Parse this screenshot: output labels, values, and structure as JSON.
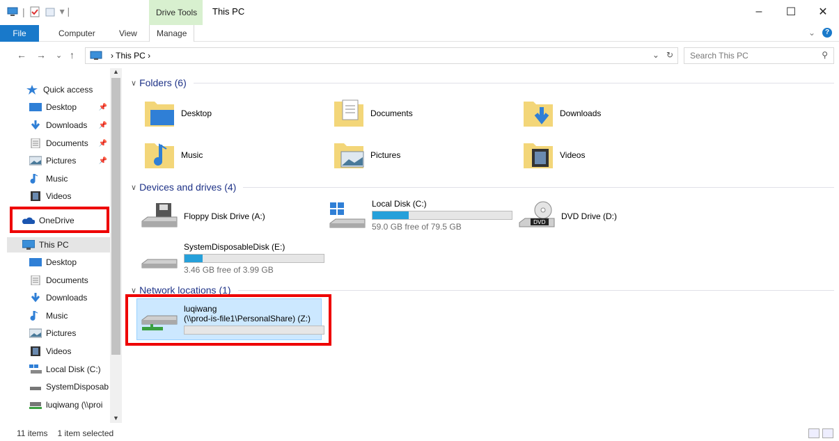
{
  "window": {
    "title": "This PC",
    "context_tab": "Drive Tools",
    "minimize": "–",
    "maximize": "☐",
    "close": "✕"
  },
  "ribbon": {
    "file": "File",
    "computer": "Computer",
    "view": "View",
    "manage": "Manage",
    "expand_glyph": "⌄",
    "help": "?"
  },
  "address": {
    "back": "←",
    "forward": "→",
    "recent": "⌄",
    "up": "↑",
    "path": "› This PC ›",
    "dropdown": "⌄",
    "refresh": "↻",
    "search_placeholder": "Search This PC",
    "search_icon": "⚲"
  },
  "nav": {
    "quick_access": "Quick access",
    "quick_items": [
      {
        "label": "Desktop",
        "pinned": true
      },
      {
        "label": "Downloads",
        "pinned": true
      },
      {
        "label": "Documents",
        "pinned": true
      },
      {
        "label": "Pictures",
        "pinned": true
      },
      {
        "label": "Music",
        "pinned": false
      },
      {
        "label": "Videos",
        "pinned": false
      }
    ],
    "onedrive": "OneDrive",
    "this_pc": "This PC",
    "pc_items": [
      "Desktop",
      "Documents",
      "Downloads",
      "Music",
      "Pictures",
      "Videos",
      "Local Disk (C:)",
      "SystemDisposab",
      "luqiwang (\\\\proi"
    ]
  },
  "groups": {
    "folders": "Folders (6)",
    "devices": "Devices and drives (4)",
    "network": "Network locations (1)"
  },
  "folders": [
    "Desktop",
    "Documents",
    "Downloads",
    "Music",
    "Pictures",
    "Videos"
  ],
  "drives": {
    "floppy": "Floppy Disk Drive (A:)",
    "c_name": "Local Disk (C:)",
    "c_free": "59.0 GB free of 79.5 GB",
    "c_used_fraction": 0.26,
    "dvd": "DVD Drive (D:)",
    "e_name": "SystemDisposableDisk (E:)",
    "e_free": "3.46 GB free of 3.99 GB",
    "e_used_fraction": 0.13
  },
  "network": {
    "name": "luqiwang",
    "path": "(\\\\prod-is-file1\\PersonalShare) (Z:)",
    "used_fraction": 0.0
  },
  "status": {
    "items": "11 items",
    "selected": "1 item selected"
  },
  "colors": {
    "accent": "#1979ca",
    "bar_fill": "#26a0da",
    "highlight": "#e00000",
    "selection": "#cce8ff",
    "context_tab": "#d8f0cf"
  }
}
